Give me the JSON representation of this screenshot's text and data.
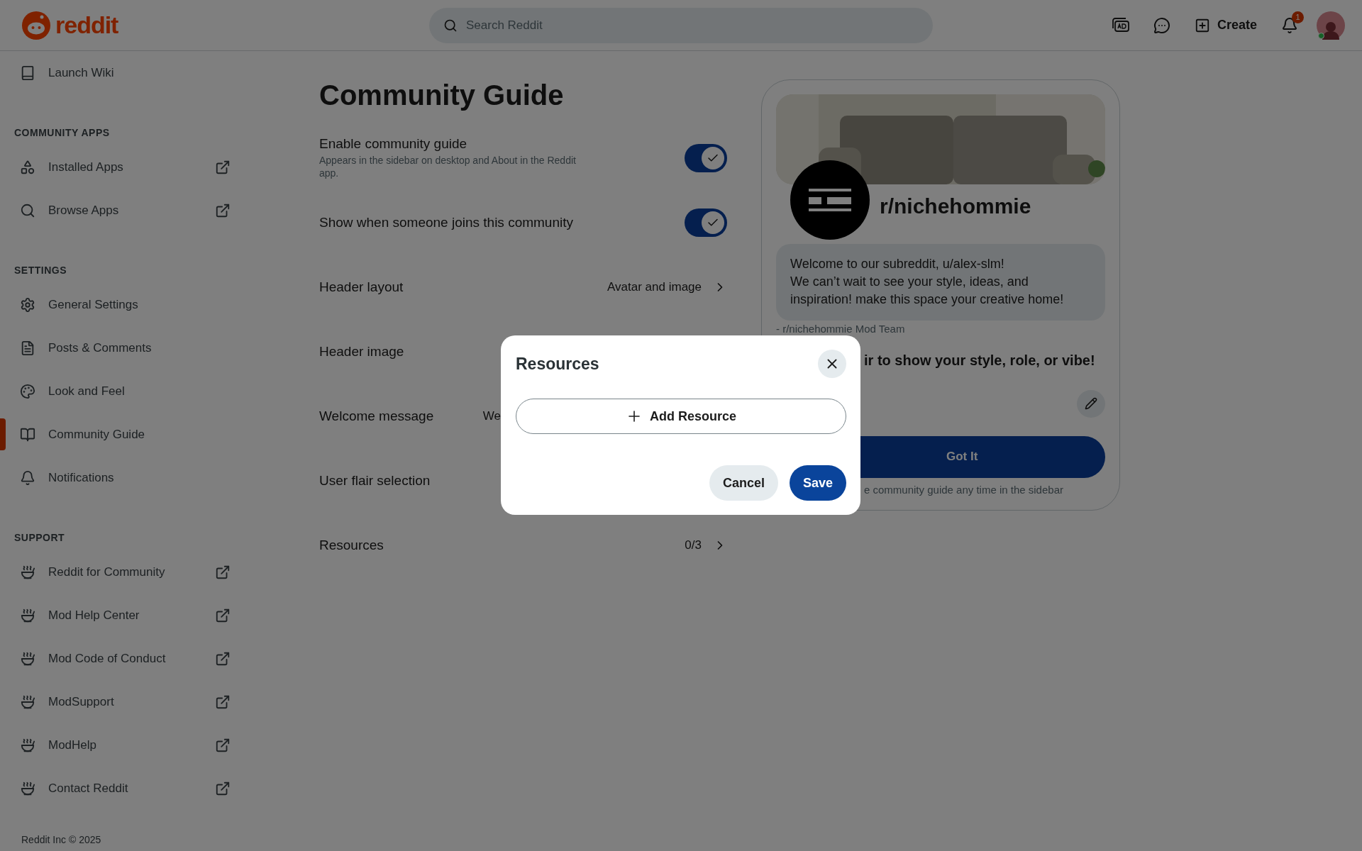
{
  "header": {
    "logo": "reddit",
    "search": {
      "placeholder": "Search Reddit"
    },
    "create": "Create",
    "notifications": "1"
  },
  "sidebar": {
    "top_item": {
      "label": "Launch Wiki"
    },
    "sections": [
      {
        "title": "COMMUNITY APPS",
        "items": [
          {
            "label": "Installed Apps",
            "external": true,
            "selected": false
          },
          {
            "label": "Browse Apps",
            "external": true,
            "selected": false
          }
        ]
      },
      {
        "title": "SETTINGS",
        "items": [
          {
            "label": "General Settings",
            "external": false,
            "selected": false
          },
          {
            "label": "Posts & Comments",
            "external": false,
            "selected": false
          },
          {
            "label": "Look and Feel",
            "external": false,
            "selected": false
          },
          {
            "label": "Community Guide",
            "external": false,
            "selected": true
          },
          {
            "label": "Notifications",
            "external": false,
            "selected": false
          }
        ]
      },
      {
        "title": "SUPPORT",
        "items": [
          {
            "label": "Reddit for Community",
            "external": true,
            "selected": false
          },
          {
            "label": "Mod Help Center",
            "external": true,
            "selected": false
          },
          {
            "label": "Mod Code of Conduct",
            "external": true,
            "selected": false
          },
          {
            "label": "ModSupport",
            "external": true,
            "selected": false
          },
          {
            "label": "ModHelp",
            "external": true,
            "selected": false
          },
          {
            "label": "Contact Reddit",
            "external": true,
            "selected": false
          }
        ]
      }
    ],
    "footer": "Reddit Inc © 2025"
  },
  "main": {
    "title": "Community Guide",
    "settings": [
      {
        "kind": "toggle",
        "label": "Enable community guide",
        "description": "Appears in the sidebar on desktop and About in the Reddit app.",
        "on": true
      },
      {
        "kind": "toggle",
        "label": "Show when someone joins this community",
        "on": true
      },
      {
        "kind": "link",
        "label": "Header layout",
        "value": "Avatar and image"
      },
      {
        "kind": "text",
        "label": "Header image"
      },
      {
        "kind": "text",
        "label": "Welcome message",
        "value": "We"
      },
      {
        "kind": "text",
        "label": "User flair selection"
      },
      {
        "kind": "link",
        "label": "Resources",
        "value": "0/3"
      }
    ]
  },
  "preview": {
    "community": "r/nichehommie",
    "welcome": "Welcome to our subreddit, u/alex-slm!\nWe can’t wait to see your style, ideas, and inspiration! make this space your creative home!",
    "signature": "- r/nichehommie Mod Team",
    "flair_prompt": "ir to show your style, role, or vibe!",
    "button": "Got It",
    "footnote": "e community guide any time in the sidebar"
  },
  "modal": {
    "title": "Resources",
    "add_button": "Add Resource",
    "buttons": {
      "cancel": "Cancel",
      "save": "Save"
    }
  }
}
